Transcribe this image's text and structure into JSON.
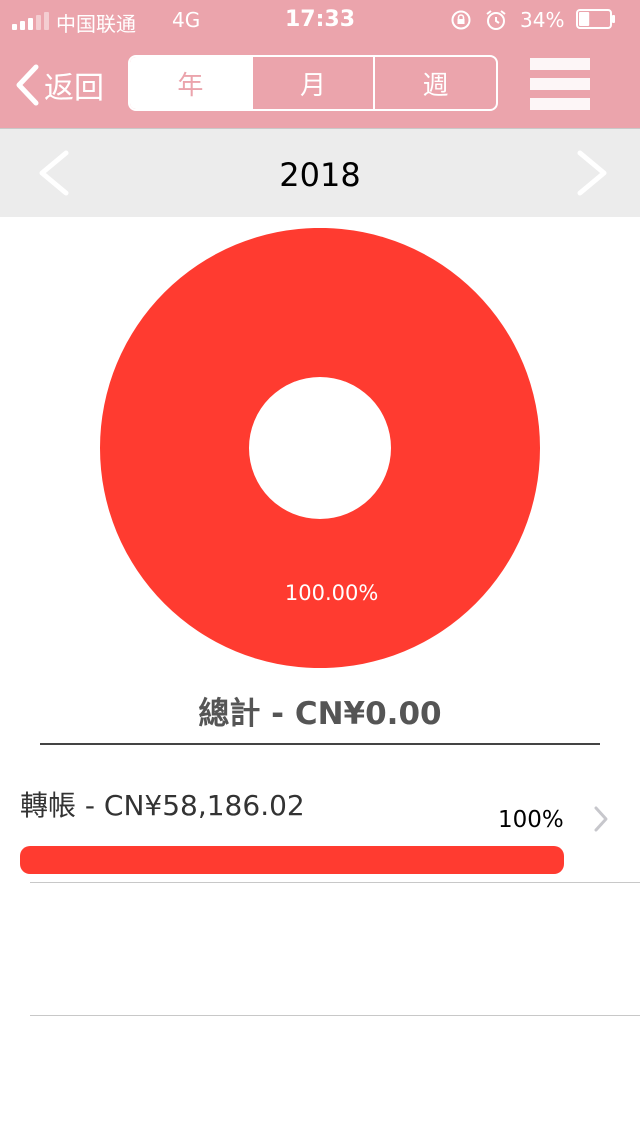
{
  "status": {
    "carrier": "中国联通",
    "network": "4G",
    "time": "17:33",
    "battery": "34%",
    "battery_level": 0.34
  },
  "nav": {
    "back_label": "返回",
    "tabs": [
      {
        "label": "年",
        "active": true
      },
      {
        "label": "月",
        "active": false
      },
      {
        "label": "週",
        "active": false
      }
    ],
    "menu_icon": "hamburger-menu-icon"
  },
  "period": {
    "year": "2018",
    "prev_icon": "chevron-left-icon",
    "next_icon": "chevron-right-icon"
  },
  "chart_data": {
    "type": "pie",
    "style": "donut",
    "slices": [
      {
        "label": "轉帳",
        "value": 100.0,
        "display": "100.00%",
        "color": "#ff3b30"
      }
    ]
  },
  "summary": {
    "total": "總計 - CN¥0.00"
  },
  "categories": [
    {
      "name": "轉帳 - CN¥58,186.02",
      "percent_text": "100%",
      "fraction": 1.0,
      "color": "#ff3b30"
    }
  ],
  "colors": {
    "header": "#eba4ac",
    "accent": "#ff3b30",
    "period_bar": "#ececec"
  }
}
